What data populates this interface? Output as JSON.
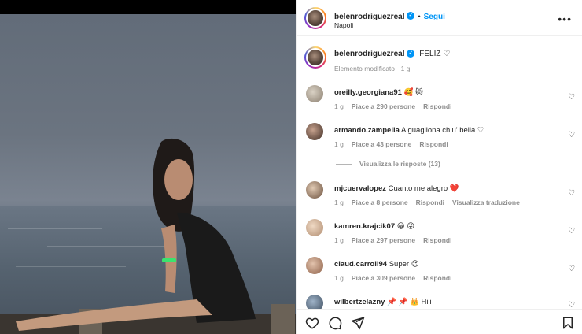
{
  "post": {
    "username": "belenrodriguezreal",
    "follow_label": "Segui",
    "location": "Napoli",
    "more_icon": "more-horizontal-icon",
    "verified_icon": "verified-badge-icon"
  },
  "caption": {
    "username": "belenrodriguezreal",
    "text": "FELIZ ♡",
    "meta": "Elemento modificato · 1 g"
  },
  "comments": [
    {
      "username": "oreilly.georgiana91",
      "text": "🥰 😻",
      "time": "1 g",
      "likes": "Piace a 290 persone",
      "reply": "Rispondi",
      "translate": ""
    },
    {
      "username": "armando.zampella",
      "text": "A guagliona chiu' bella ♡",
      "time": "1 g",
      "likes": "Piace a 43 persone",
      "reply": "Rispondi",
      "translate": ""
    },
    {
      "username": "mjcuervalopez",
      "text": "Cuanto me alegro ❤️",
      "time": "1 g",
      "likes": "Piace a 8 persone",
      "reply": "Rispondi",
      "translate": "Visualizza traduzione"
    },
    {
      "username": "kamren.krajcik07",
      "text": "😀 😜",
      "time": "1 g",
      "likes": "Piace a 297 persone",
      "reply": "Rispondi",
      "translate": ""
    },
    {
      "username": "claud.carroll94",
      "text": "Super 😍",
      "time": "1 g",
      "likes": "Piace a 309 persone",
      "reply": "Rispondi",
      "translate": ""
    },
    {
      "username": "wilbertzelazny",
      "text": "📌 📌 👑 Hiii",
      "time": "",
      "likes": "",
      "reply": "",
      "translate": ""
    }
  ],
  "view_replies": "Visualizza le risposte (13)",
  "actions": {
    "like_icon": "heart-icon",
    "comment_icon": "comment-icon",
    "share_icon": "share-icon",
    "save_icon": "bookmark-icon"
  },
  "colors": {
    "accent": "#0095f6",
    "text": "#262626",
    "muted": "#8e8e8e"
  }
}
